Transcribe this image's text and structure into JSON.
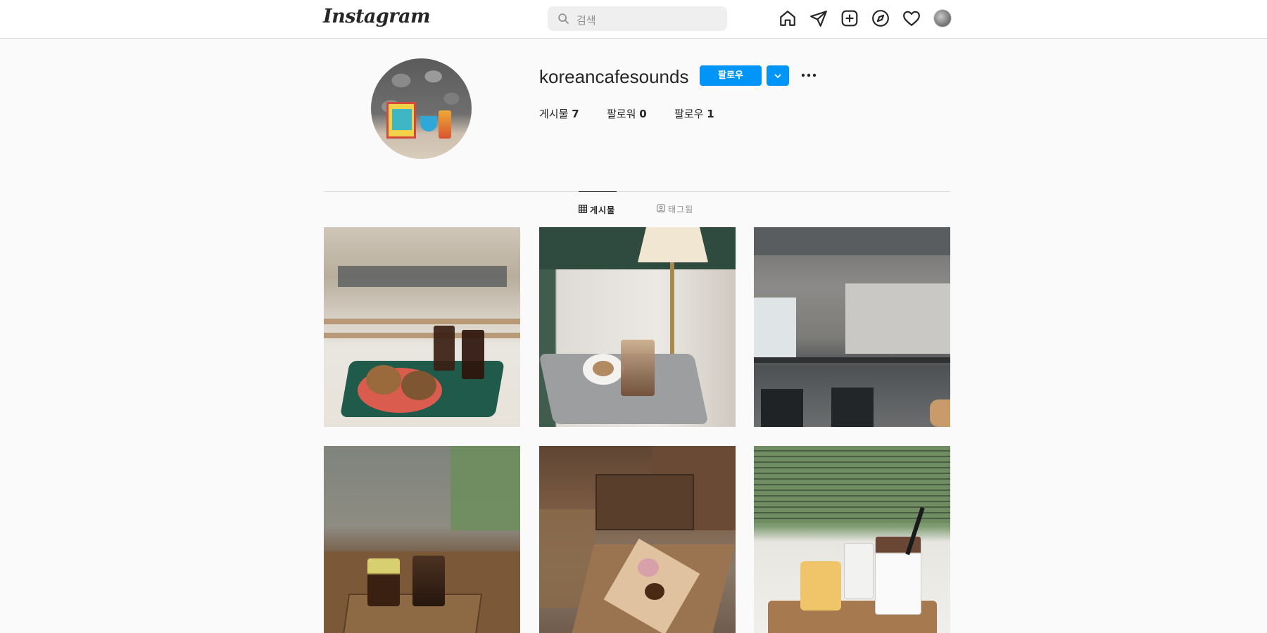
{
  "nav": {
    "logo": "Instagram",
    "search_placeholder": "검색",
    "icons": [
      "home-icon",
      "direct-message-icon",
      "new-post-icon",
      "explore-icon",
      "activity-heart-icon",
      "profile-avatar-icon"
    ]
  },
  "profile": {
    "username": "koreancafesounds",
    "follow_label": "팔로우",
    "stats": {
      "posts_label": "게시물",
      "posts_count": "7",
      "followers_label": "팔로워",
      "followers_count": "0",
      "following_label": "팔로우",
      "following_count": "1"
    }
  },
  "tabs": [
    {
      "label": "게시물",
      "active": true
    },
    {
      "label": "태그됨",
      "active": false
    }
  ],
  "colors": {
    "accent": "#0095f6",
    "text": "#262626",
    "muted": "#8e8e8e",
    "border": "#dbdbdb",
    "background": "#fafafa"
  }
}
